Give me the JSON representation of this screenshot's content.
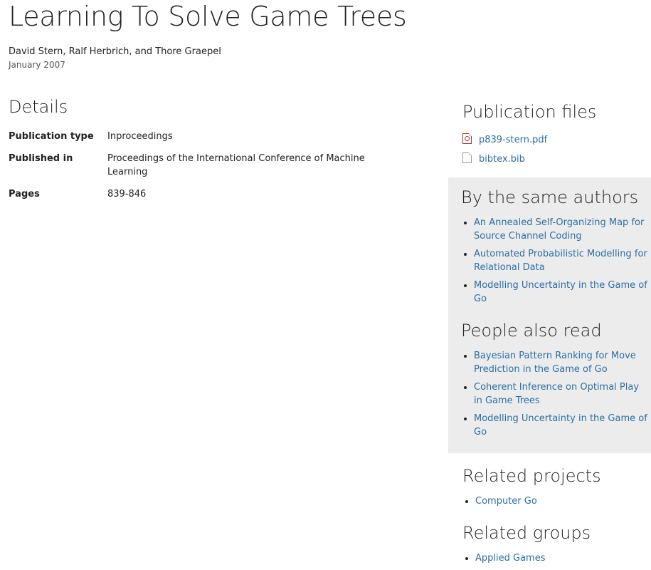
{
  "publication": {
    "title": "Learning To Solve Game Trees",
    "authors": "David Stern, Ralf Herbrich, and Thore Graepel",
    "date": "January 2007"
  },
  "details": {
    "heading": "Details",
    "rows": [
      {
        "label": "Publication type",
        "value": "Inproceedings"
      },
      {
        "label": "Published in",
        "value": "Proceedings of the International Conference of Machine Learning"
      },
      {
        "label": "Pages",
        "value": "839-846"
      }
    ]
  },
  "sidebar": {
    "files": {
      "heading": "Publication files",
      "items": [
        {
          "name": "p839-stern.pdf",
          "icon": "pdf-file-icon"
        },
        {
          "name": "bibtex.bib",
          "icon": "file-icon"
        }
      ]
    },
    "same_authors": {
      "heading": "By the same authors",
      "items": [
        "An Annealed Self-Organizing Map for Source Channel Coding",
        "Automated Probabilistic Modelling for Relational Data",
        "Modelling Uncertainty in the Game of Go"
      ]
    },
    "also_read": {
      "heading": "People also read",
      "items": [
        "Bayesian Pattern Ranking for Move Prediction in the Game of Go",
        "Coherent Inference on Optimal Play in Game Trees",
        "Modelling Uncertainty in the Game of Go"
      ]
    },
    "projects": {
      "heading": "Related projects",
      "items": [
        "Computer Go"
      ]
    },
    "groups": {
      "heading": "Related groups",
      "items": [
        "Applied Games"
      ]
    }
  },
  "colors": {
    "link": "#2a6ea6",
    "text": "#222222",
    "muted": "#555555",
    "box_background": "#ececec"
  }
}
